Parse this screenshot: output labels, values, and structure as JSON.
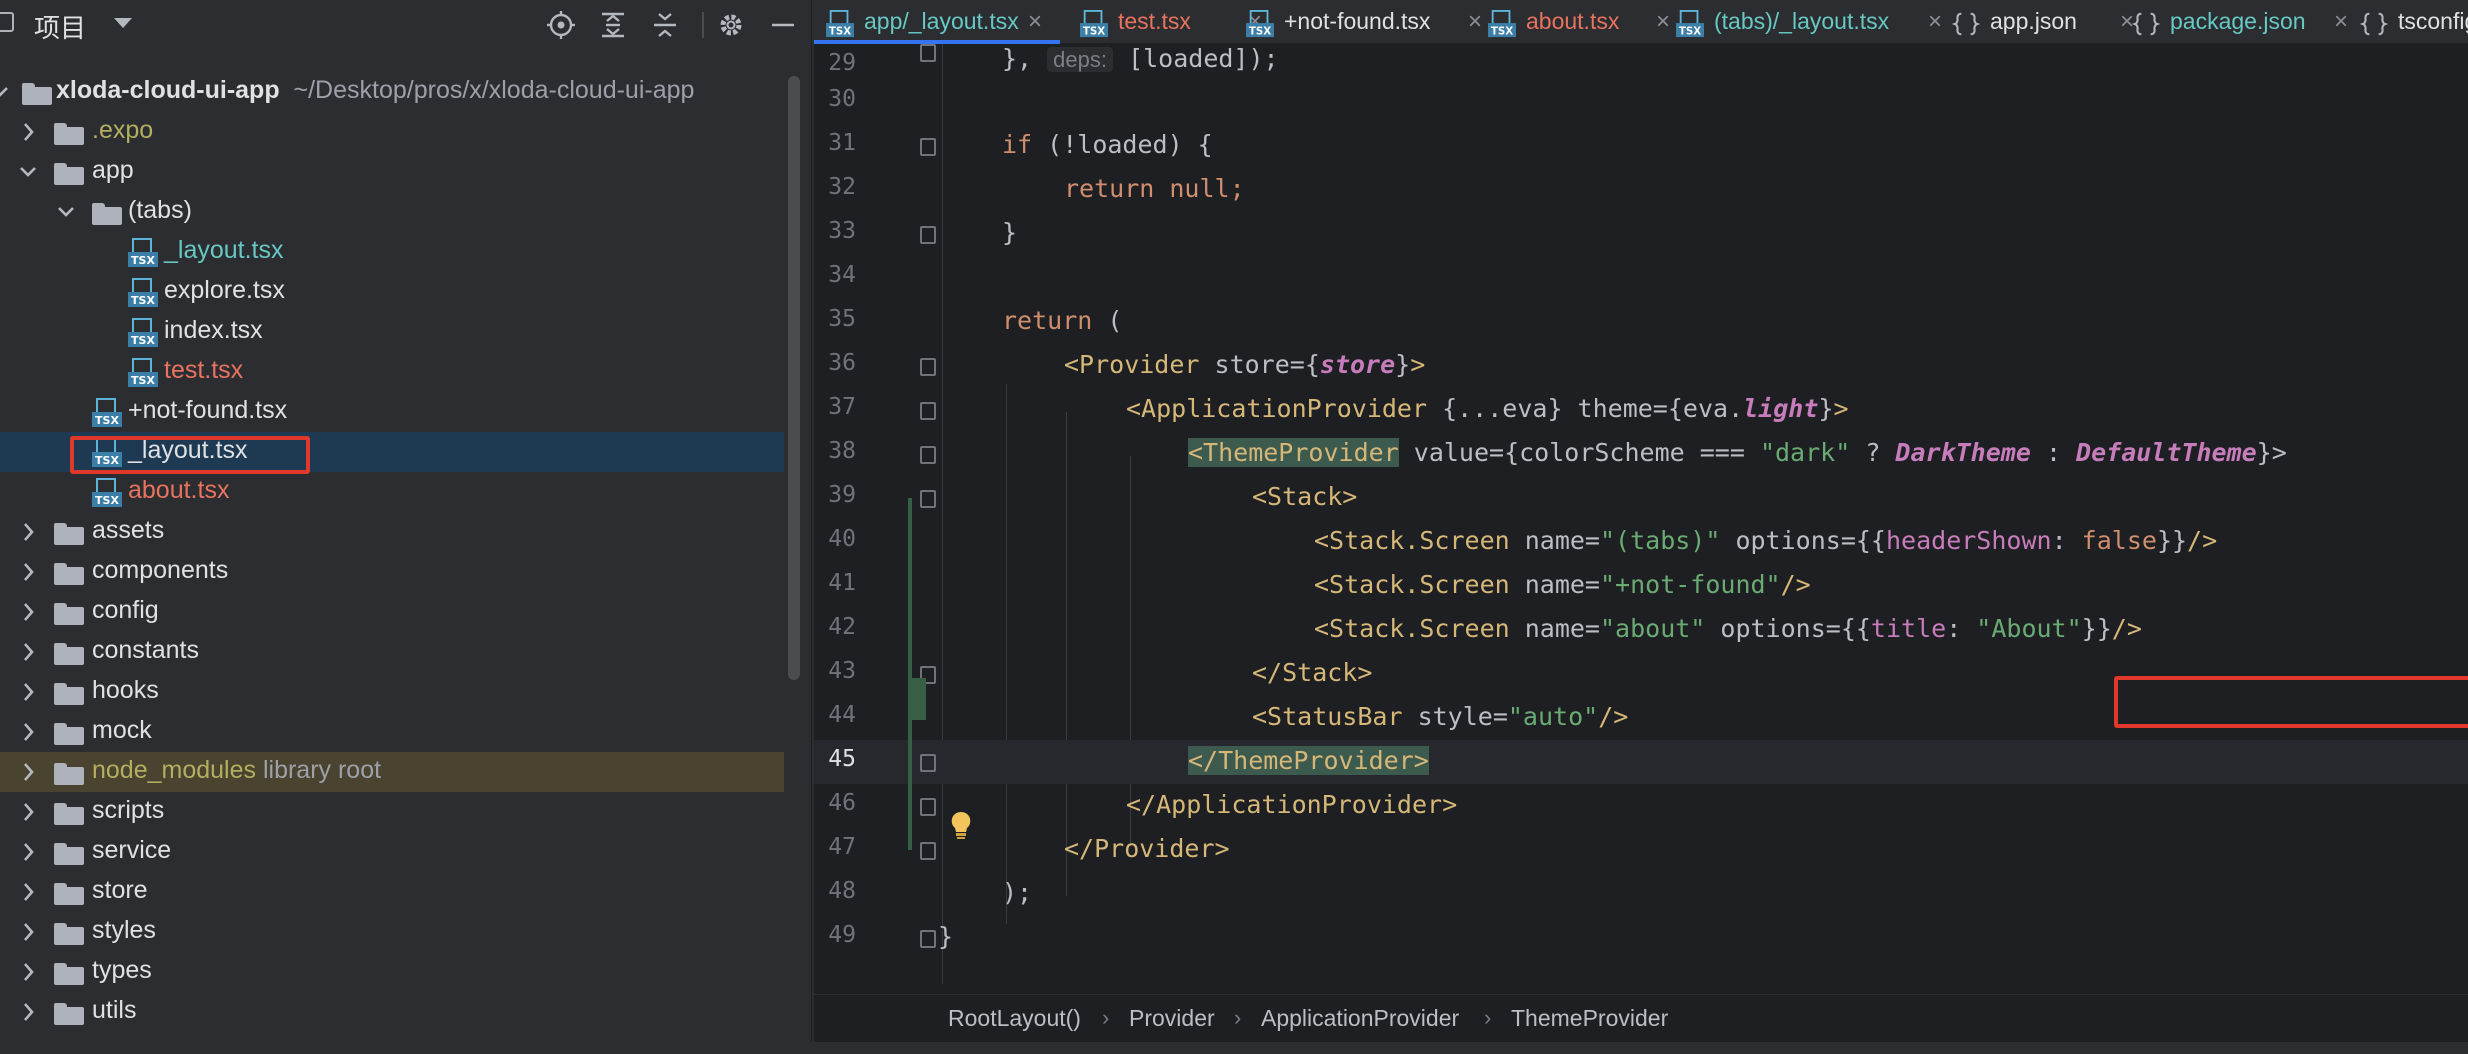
{
  "project_panel": {
    "title": "项目",
    "tree": [
      {
        "label": "xloda-cloud-ui-app",
        "hint": "~/Desktop/pros/x/xloda-cloud-ui-app",
        "type": "folder"
      },
      {
        "label": ".expo",
        "type": "folder"
      },
      {
        "label": "app",
        "type": "folder"
      },
      {
        "label": "(tabs)",
        "type": "folder"
      },
      {
        "label": "_layout.tsx",
        "type": "tsx"
      },
      {
        "label": "explore.tsx",
        "type": "tsx"
      },
      {
        "label": "index.tsx",
        "type": "tsx"
      },
      {
        "label": "test.tsx",
        "type": "tsx"
      },
      {
        "label": "+not-found.tsx",
        "type": "tsx"
      },
      {
        "label": "_layout.tsx",
        "type": "tsx"
      },
      {
        "label": "about.tsx",
        "type": "tsx"
      },
      {
        "label": "assets",
        "type": "folder"
      },
      {
        "label": "components",
        "type": "folder"
      },
      {
        "label": "config",
        "type": "folder"
      },
      {
        "label": "constants",
        "type": "folder"
      },
      {
        "label": "hooks",
        "type": "folder"
      },
      {
        "label": "mock",
        "type": "folder"
      },
      {
        "label": "node_modules",
        "hint": "library root",
        "type": "folder"
      },
      {
        "label": "scripts",
        "type": "folder"
      },
      {
        "label": "service",
        "type": "folder"
      },
      {
        "label": "store",
        "type": "folder"
      },
      {
        "label": "styles",
        "type": "folder"
      },
      {
        "label": "types",
        "type": "folder"
      },
      {
        "label": "utils",
        "type": "folder"
      }
    ]
  },
  "tabs": [
    {
      "label": "app/_layout.tsx",
      "close": "×"
    },
    {
      "label": "test.tsx",
      "close": "×"
    },
    {
      "label": "+not-found.tsx",
      "close": "×"
    },
    {
      "label": "about.tsx",
      "close": "×"
    },
    {
      "label": "(tabs)/_layout.tsx",
      "close": "×"
    },
    {
      "label": "app.json",
      "close": "×"
    },
    {
      "label": "package.json",
      "close": "×"
    },
    {
      "label": "tsconfig",
      "close": ""
    }
  ],
  "line_numbers": [
    "29",
    "30",
    "31",
    "32",
    "33",
    "34",
    "35",
    "36",
    "37",
    "38",
    "39",
    "40",
    "41",
    "42",
    "43",
    "44",
    "45",
    "46",
    "47",
    "48",
    "49"
  ],
  "code": {
    "l29_a": "},",
    "l29_hint": "deps:",
    "l29_b": "[loaded]);",
    "l31_kw": "if",
    "l31_rest": " (!loaded) {",
    "l32_kw": "return",
    "l32_rest": " null;",
    "l33": "}",
    "l35_kw": "return",
    "l35_rest": " (",
    "l36_tag": "<Provider",
    "l36_attr": " store=",
    "l36_ob": "{",
    "l36_val": "store",
    "l36_cb": "}",
    "l36_end": ">",
    "l37_tag": "<ApplicationProvider",
    "l37_rest": " {...eva} theme=",
    "l37_ob": "{eva.",
    "l37_val": "light",
    "l37_cb": "}",
    "l37_end": ">",
    "l38_tag": "<ThemeProvider",
    "l38_attr": " value=",
    "l38_a": "{colorScheme === ",
    "l38_str": "\"dark\"",
    "l38_b": " ? ",
    "l38_v1": "DarkTheme",
    "l38_c": " : ",
    "l38_v2": "DefaultTheme",
    "l38_end": "}>",
    "l39_tag": "<Stack>",
    "l40_tag": "<Stack.Screen",
    "l40_a": " name=",
    "l40_str": "\"(tabs)\"",
    "l40_b": " options=",
    "l40_c": "{{",
    "l40_prop": "headerShown",
    "l40_d": ": ",
    "l40_kw": "false",
    "l40_e": "}}",
    "l40_end": "/>",
    "l41_tag": "<Stack.Screen",
    "l41_a": " name=",
    "l41_str": "\"+not-found\"",
    "l41_end": "/>",
    "l42_tag": "<Stack.Screen",
    "l42_a": " name=",
    "l42_str": "\"about\"",
    "l42_b": " options=",
    "l42_c": "{{",
    "l42_prop": "title",
    "l42_d": ": ",
    "l42_str2": "\"About\"",
    "l42_e": "}}",
    "l42_end": "/>",
    "l43_tag": "</Stack>",
    "l44_tag": "<StatusBar",
    "l44_a": " style=",
    "l44_str": "\"auto\"",
    "l44_end": "/>",
    "l45_tag": "</ThemeProvider>",
    "l46_tag": "</ApplicationProvider>",
    "l47_tag": "</Provider>",
    "l48": ");",
    "l49": "}"
  },
  "breadcrumb": [
    "RootLayout()",
    "Provider",
    "ApplicationProvider",
    "ThemeProvider"
  ],
  "breadcrumb_sep": "›",
  "colors": {
    "accent": "#3574f0",
    "highlight": "#e0382b",
    "selection": "#1e3a52"
  }
}
